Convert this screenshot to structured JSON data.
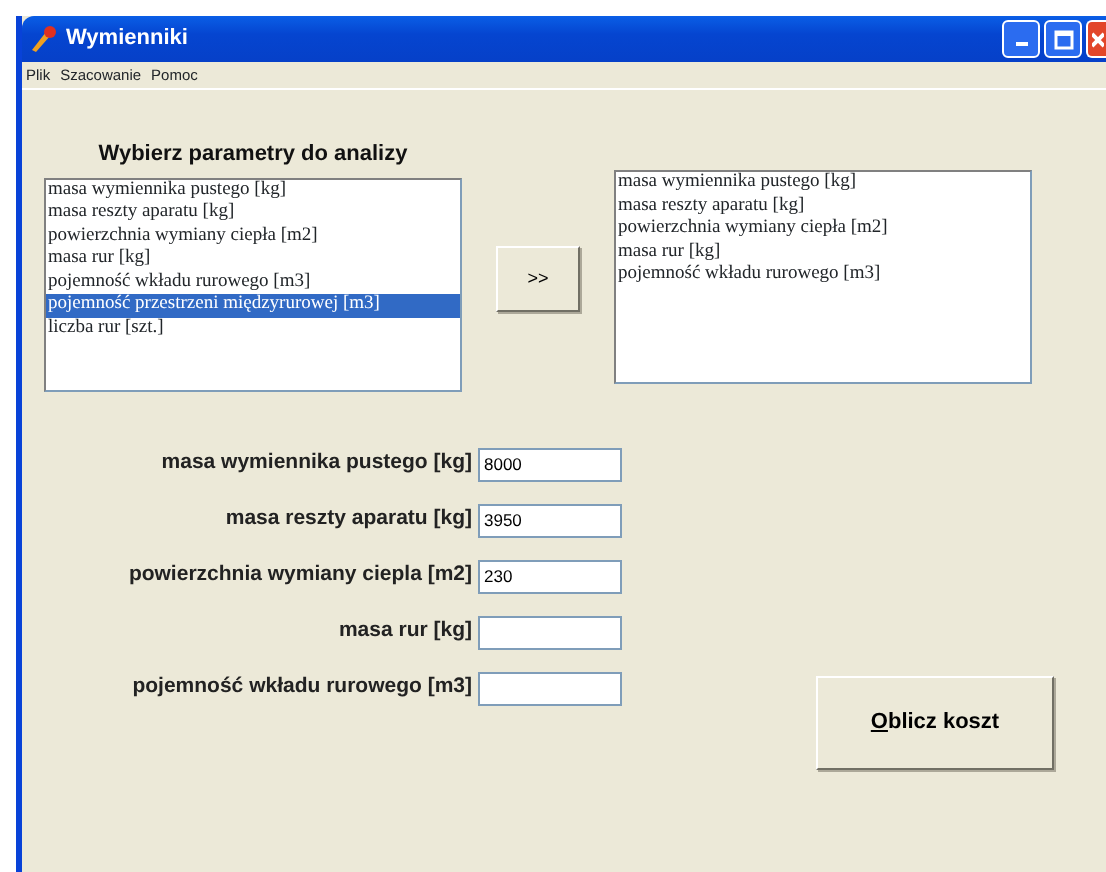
{
  "window": {
    "title": "Wymienniki"
  },
  "menu": [
    {
      "label": "Plik"
    },
    {
      "label": "Szacowanie"
    },
    {
      "label": "Pomoc"
    }
  ],
  "parameter_list": {
    "heading": "Wybierz parametry do analizy",
    "items": [
      {
        "label": "masa wymiennika pustego [kg]",
        "selected": false
      },
      {
        "label": "masa reszty aparatu [kg]",
        "selected": false
      },
      {
        "label": "powierzchnia wymiany ciepła [m2]",
        "selected": false
      },
      {
        "label": "masa rur [kg]",
        "selected": false
      },
      {
        "label": "pojemność wkładu rurowego [m3]",
        "selected": false
      },
      {
        "label": "pojemność przestrzeni międzyrurowej [m3]",
        "selected": true
      },
      {
        "label": "liczba rur [szt.]",
        "selected": false
      }
    ]
  },
  "move_button": {
    "label": ">>"
  },
  "chosen_list": {
    "items": [
      {
        "label": "masa wymiennika pustego [kg]"
      },
      {
        "label": "masa reszty aparatu [kg]"
      },
      {
        "label": "powierzchnia wymiany ciepła [m2]"
      },
      {
        "label": "masa rur [kg]"
      },
      {
        "label": "pojemność wkładu rurowego [m3]"
      }
    ]
  },
  "fields": [
    {
      "label": "masa wymiennika pustego [kg]",
      "value": "8000"
    },
    {
      "label": "masa reszty aparatu [kg]",
      "value": "3950"
    },
    {
      "label": "powierzchnia wymiany ciepla [m2]",
      "value": "230"
    },
    {
      "label": "masa rur [kg]"
    },
    {
      "label": "pojemność wkładu rurowego [m3]"
    }
  ],
  "calculate_button": {
    "label": "Oblicz koszt",
    "access_key_underlined": true
  }
}
